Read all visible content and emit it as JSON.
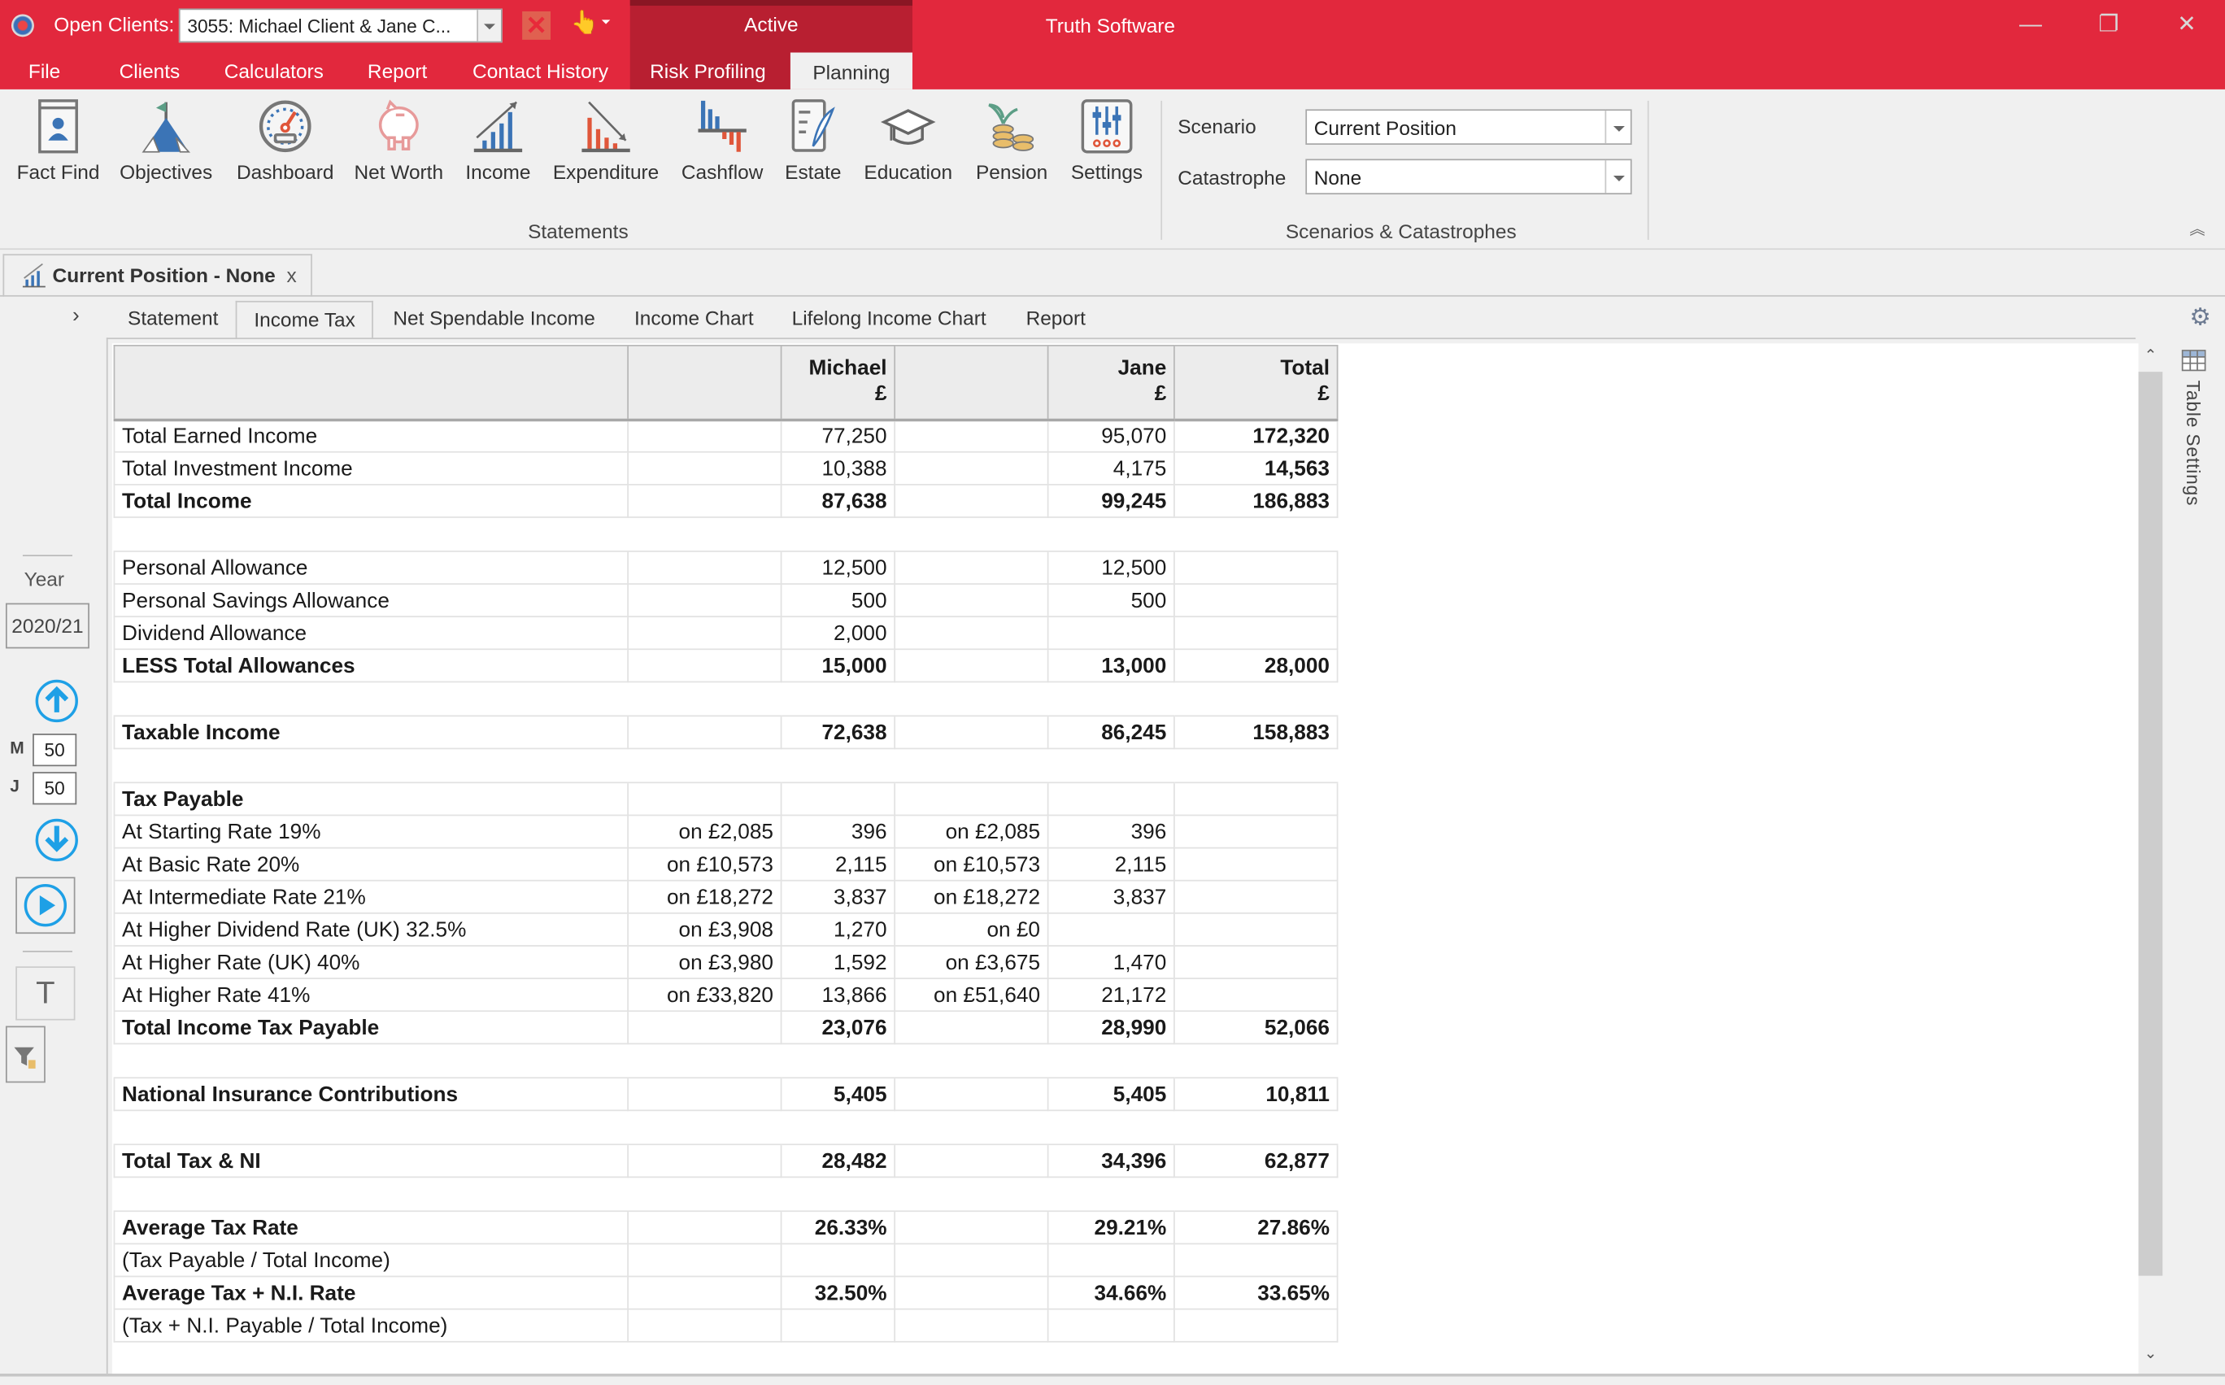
{
  "titlebar": {
    "open_clients_label": "Open Clients:",
    "client_selected": "3055: Michael Client & Jane C...",
    "context_tab_label": "Active",
    "app_title": "Truth Software",
    "window_buttons": {
      "minimize": "—",
      "restore": "❐",
      "close": "✕"
    }
  },
  "menu": {
    "items": [
      "File",
      "Clients",
      "Calculators",
      "Report",
      "Contact History",
      "Risk Profiling",
      "Planning"
    ],
    "active": "Planning"
  },
  "ribbon": {
    "statements_group_label": "Statements",
    "buttons": [
      {
        "label": "Fact Find",
        "icon": "fact-find-icon"
      },
      {
        "label": "Objectives",
        "icon": "objectives-icon"
      },
      {
        "label": "Dashboard",
        "icon": "dashboard-icon"
      },
      {
        "label": "Net Worth",
        "icon": "piggy-bank-icon"
      },
      {
        "label": "Income",
        "icon": "income-chart-icon"
      },
      {
        "label": "Expenditure",
        "icon": "expenditure-chart-icon"
      },
      {
        "label": "Cashflow",
        "icon": "cashflow-chart-icon"
      },
      {
        "label": "Estate",
        "icon": "estate-document-icon"
      },
      {
        "label": "Education",
        "icon": "graduation-cap-icon"
      },
      {
        "label": "Pension",
        "icon": "pension-coins-icon"
      },
      {
        "label": "Settings",
        "icon": "settings-sliders-icon"
      }
    ],
    "scenario_label": "Scenario",
    "scenario_value": "Current Position",
    "catastrophe_label": "Catastrophe",
    "catastrophe_value": "None",
    "scenarios_group_label": "Scenarios & Catastrophes"
  },
  "document_tab": {
    "title": "Current Position - None",
    "close": "x"
  },
  "subtabs": {
    "items": [
      "Statement",
      "Income Tax",
      "Net Spendable Income",
      "Income Chart",
      "Lifelong Income Chart",
      "Report"
    ],
    "active": "Income Tax"
  },
  "sidebar": {
    "year_label": "Year",
    "year_value": "2020/21",
    "m_label": "M",
    "m_age": "50",
    "j_label": "J",
    "j_age": "50",
    "t_label": "T"
  },
  "table_settings_label": "Table Settings",
  "table": {
    "headers": [
      {
        "line1": "",
        "line2": ""
      },
      {
        "line1": "",
        "line2": ""
      },
      {
        "line1": "Michael",
        "line2": "£"
      },
      {
        "line1": "",
        "line2": ""
      },
      {
        "line1": "Jane",
        "line2": "£"
      },
      {
        "line1": "Total",
        "line2": "£"
      }
    ],
    "rows": [
      {
        "label": "Total Earned Income",
        "m_on": "",
        "m": "77,250",
        "j_on": "",
        "j": "95,070",
        "total": "172,320",
        "bold": false
      },
      {
        "label": "Total Investment Income",
        "m_on": "",
        "m": "10,388",
        "j_on": "",
        "j": "4,175",
        "total": "14,563",
        "bold": false
      },
      {
        "label": "Total Income",
        "m_on": "",
        "m": "87,638",
        "j_on": "",
        "j": "99,245",
        "total": "186,883",
        "bold": true
      },
      {
        "spacer": true
      },
      {
        "label": "Personal Allowance",
        "m_on": "",
        "m": "12,500",
        "j_on": "",
        "j": "12,500",
        "total": "",
        "bold": false
      },
      {
        "label": "Personal Savings Allowance",
        "m_on": "",
        "m": "500",
        "j_on": "",
        "j": "500",
        "total": "",
        "bold": false
      },
      {
        "label": "Dividend Allowance",
        "m_on": "",
        "m": "2,000",
        "j_on": "",
        "j": "",
        "total": "",
        "bold": false
      },
      {
        "label": "LESS Total Allowances",
        "m_on": "",
        "m": "15,000",
        "j_on": "",
        "j": "13,000",
        "total": "28,000",
        "bold": true
      },
      {
        "spacer": true
      },
      {
        "label": "Taxable Income",
        "m_on": "",
        "m": "72,638",
        "j_on": "",
        "j": "86,245",
        "total": "158,883",
        "bold": true
      },
      {
        "spacer": true
      },
      {
        "label": "Tax Payable",
        "m_on": "",
        "m": "",
        "j_on": "",
        "j": "",
        "total": "",
        "bold": true
      },
      {
        "label": "At Starting Rate 19%",
        "m_on": "on £2,085",
        "m": "396",
        "j_on": "on £2,085",
        "j": "396",
        "total": "",
        "bold": false
      },
      {
        "label": "At Basic Rate 20%",
        "m_on": "on £10,573",
        "m": "2,115",
        "j_on": "on £10,573",
        "j": "2,115",
        "total": "",
        "bold": false
      },
      {
        "label": "At Intermediate Rate 21%",
        "m_on": "on £18,272",
        "m": "3,837",
        "j_on": "on £18,272",
        "j": "3,837",
        "total": "",
        "bold": false
      },
      {
        "label": "At Higher Dividend Rate (UK) 32.5%",
        "m_on": "on £3,908",
        "m": "1,270",
        "j_on": "on £0",
        "j": "",
        "total": "",
        "bold": false
      },
      {
        "label": "At Higher Rate (UK) 40%",
        "m_on": "on £3,980",
        "m": "1,592",
        "j_on": "on £3,675",
        "j": "1,470",
        "total": "",
        "bold": false
      },
      {
        "label": "At Higher Rate 41%",
        "m_on": "on £33,820",
        "m": "13,866",
        "j_on": "on £51,640",
        "j": "21,172",
        "total": "",
        "bold": false
      },
      {
        "label": "Total Income Tax Payable",
        "m_on": "",
        "m": "23,076",
        "j_on": "",
        "j": "28,990",
        "total": "52,066",
        "bold": true
      },
      {
        "spacer": true
      },
      {
        "label": "National Insurance Contributions",
        "m_on": "",
        "m": "5,405",
        "j_on": "",
        "j": "5,405",
        "total": "10,811",
        "bold": true
      },
      {
        "spacer": true
      },
      {
        "label": "Total Tax & NI",
        "m_on": "",
        "m": "28,482",
        "j_on": "",
        "j": "34,396",
        "total": "62,877",
        "bold": true
      },
      {
        "spacer": true
      },
      {
        "label": "Average Tax Rate",
        "m_on": "",
        "m": "26.33%",
        "j_on": "",
        "j": "29.21%",
        "total": "27.86%",
        "bold": true
      },
      {
        "label": "(Tax Payable / Total Income)",
        "m_on": "",
        "m": "",
        "j_on": "",
        "j": "",
        "total": "",
        "bold": false
      },
      {
        "label": "Average Tax + N.I. Rate",
        "m_on": "",
        "m": "32.50%",
        "j_on": "",
        "j": "34.66%",
        "total": "33.65%",
        "bold": true
      },
      {
        "label": "(Tax + N.I. Payable / Total Income)",
        "m_on": "",
        "m": "",
        "j_on": "",
        "j": "",
        "total": "",
        "bold": false
      }
    ]
  },
  "colors": {
    "brand_red": "#e2283d",
    "context_red": "#b81f31",
    "accent_blue": "#1ea0e6"
  }
}
